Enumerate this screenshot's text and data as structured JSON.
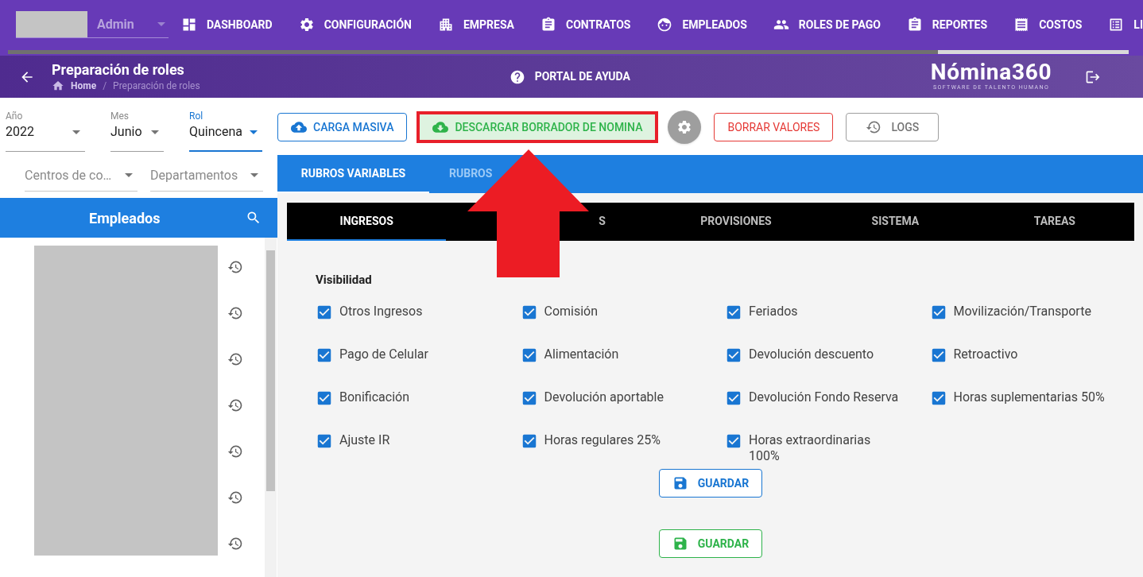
{
  "nav": {
    "user": "Admin",
    "items": [
      {
        "label": "DASHBOARD"
      },
      {
        "label": "CONFIGURACIÓN"
      },
      {
        "label": "EMPRESA"
      },
      {
        "label": "CONTRATOS"
      },
      {
        "label": "EMPLEADOS"
      },
      {
        "label": "ROLES DE PAGO"
      },
      {
        "label": "REPORTES"
      },
      {
        "label": "COSTOS"
      },
      {
        "label": "LI"
      }
    ],
    "progress": {
      "level": 0.83
    }
  },
  "header": {
    "title": "Preparación de roles",
    "breadcrumb": [
      "Home",
      "Preparación de roles"
    ],
    "breadcrumb_separator": "/",
    "help": "PORTAL DE AYUDA",
    "logo": "Nómina360",
    "logo_tagline": "SOFTWARE DE TALENTO HUMANO"
  },
  "filters": [
    {
      "label": "Año",
      "value": "2022",
      "focused": false
    },
    {
      "label": "Mes",
      "value": "Junio",
      "focused": false
    },
    {
      "label": "Rol",
      "value": "Quincena",
      "focused": true
    }
  ],
  "filters2": [
    {
      "placeholder": "Centros de co…"
    },
    {
      "placeholder": "Departamentos"
    }
  ],
  "employees": {
    "title": "Empleados"
  },
  "actions": [
    {
      "label": "CARGA MASIVA",
      "kind": "upload",
      "highlighted": false
    },
    {
      "label": "DESCARGAR BORRADOR DE NOMINA",
      "kind": "download",
      "highlighted": true
    },
    {
      "kind": "settings",
      "highlighted": false
    },
    {
      "label": "BORRAR VALORES",
      "kind": "danger",
      "highlighted": false
    },
    {
      "label": "LOGS",
      "kind": "logs",
      "highlighted": false
    }
  ],
  "tabs": [
    {
      "label": "RUBROS VARIABLES",
      "selected": true
    },
    {
      "label": "RUBROS",
      "selected": false
    }
  ],
  "subtabs": [
    {
      "label": "INGRESOS",
      "selected": true
    },
    {
      "label": "S",
      "selected": false
    },
    {
      "label": "PROVISIONES",
      "selected": false
    },
    {
      "label": "SISTEMA",
      "selected": false
    },
    {
      "label": "TAREAS",
      "selected": false
    }
  ],
  "visibility": {
    "title": "Visibilidad",
    "items": [
      {
        "label": "Otros Ingresos",
        "checked": true
      },
      {
        "label": "Comisión",
        "checked": true
      },
      {
        "label": "Feriados",
        "checked": true
      },
      {
        "label": "Movilización/Transporte",
        "checked": true
      },
      {
        "label": "Pago de Celular",
        "checked": true
      },
      {
        "label": "Alimentación",
        "checked": true
      },
      {
        "label": "Devolución descuento",
        "checked": true
      },
      {
        "label": "Retroactivo",
        "checked": true
      },
      {
        "label": "Bonificación",
        "checked": true
      },
      {
        "label": "Devolución aportable",
        "checked": true
      },
      {
        "label": "Devolución Fondo Reserva",
        "checked": true
      },
      {
        "label": "Horas suplementarias 50%",
        "checked": true
      },
      {
        "label": "Ajuste IR",
        "checked": true
      },
      {
        "label": "Horas regulares 25%",
        "checked": true
      },
      {
        "label": "Horas extraordinarias 100%",
        "checked": true
      }
    ]
  },
  "save_buttons": [
    {
      "label": "GUARDAR",
      "kind": "primary"
    },
    {
      "label": "GUARDAR",
      "kind": "success"
    }
  ]
}
